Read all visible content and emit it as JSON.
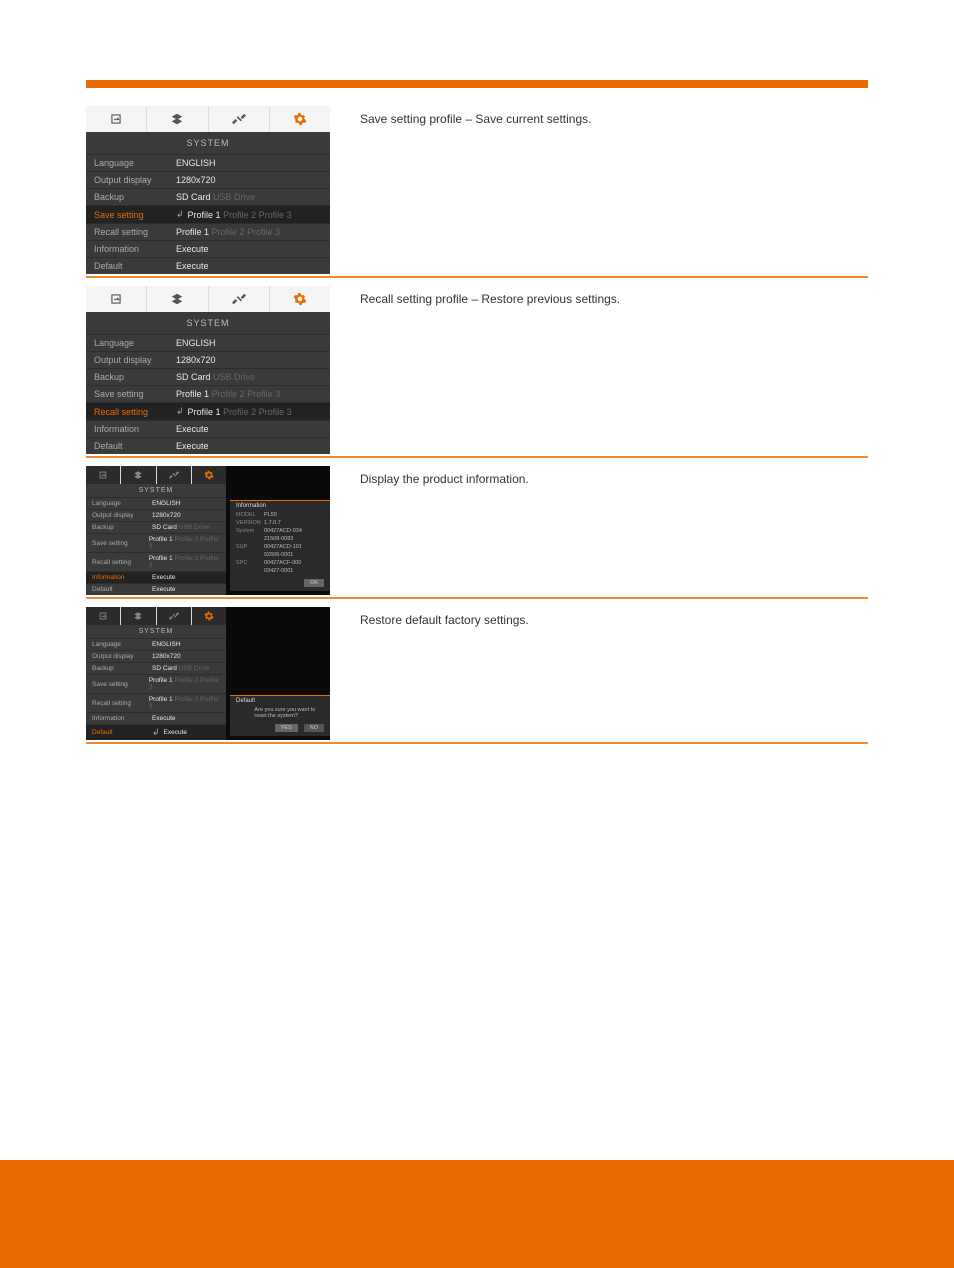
{
  "blocks": [
    {
      "desc": "Save setting profile – Save current settings.",
      "panel": {
        "title": "SYSTEM",
        "rows": [
          {
            "label": "Language",
            "vals": [
              {
                "t": "ENGLISH",
                "c": "cur"
              }
            ],
            "sel": false,
            "arrow": false
          },
          {
            "label": "Output display",
            "vals": [
              {
                "t": "1280x720",
                "c": "cur"
              }
            ],
            "sel": false,
            "arrow": false
          },
          {
            "label": "Backup",
            "vals": [
              {
                "t": "SD Card",
                "c": "cur"
              },
              {
                "t": "USB Drive",
                "c": "dim"
              }
            ],
            "sel": false,
            "arrow": false
          },
          {
            "label": "Save setting",
            "vals": [
              {
                "t": "Profile 1",
                "c": "cur"
              },
              {
                "t": "Profile 2",
                "c": "dim"
              },
              {
                "t": "Profile 3",
                "c": "dim"
              }
            ],
            "sel": true,
            "arrow": true
          },
          {
            "label": "Recall setting",
            "vals": [
              {
                "t": "Profile 1",
                "c": "cur"
              },
              {
                "t": "Profile 2",
                "c": "dim"
              },
              {
                "t": "Profile 3",
                "c": "dim"
              }
            ],
            "sel": false,
            "arrow": false
          },
          {
            "label": "Information",
            "vals": [
              {
                "t": "Execute",
                "c": "cur"
              }
            ],
            "sel": false,
            "arrow": false
          },
          {
            "label": "Default",
            "vals": [
              {
                "t": "Execute",
                "c": "cur"
              }
            ],
            "sel": false,
            "arrow": false
          }
        ]
      }
    },
    {
      "desc": "Recall setting profile – Restore previous settings.",
      "panel": {
        "title": "SYSTEM",
        "rows": [
          {
            "label": "Language",
            "vals": [
              {
                "t": "ENGLISH",
                "c": "cur"
              }
            ],
            "sel": false,
            "arrow": false
          },
          {
            "label": "Output display",
            "vals": [
              {
                "t": "1280x720",
                "c": "cur"
              }
            ],
            "sel": false,
            "arrow": false
          },
          {
            "label": "Backup",
            "vals": [
              {
                "t": "SD Card",
                "c": "cur"
              },
              {
                "t": "USB Drive",
                "c": "dim"
              }
            ],
            "sel": false,
            "arrow": false
          },
          {
            "label": "Save setting",
            "vals": [
              {
                "t": "Profile 1",
                "c": "cur"
              },
              {
                "t": "Profile 2",
                "c": "dim"
              },
              {
                "t": "Profile 3",
                "c": "dim"
              }
            ],
            "sel": false,
            "arrow": false
          },
          {
            "label": "Recall setting",
            "vals": [
              {
                "t": "Profile 1",
                "c": "cur"
              },
              {
                "t": "Profile 2",
                "c": "dim"
              },
              {
                "t": "Profile 3",
                "c": "dim"
              }
            ],
            "sel": true,
            "arrow": true
          },
          {
            "label": "Information",
            "vals": [
              {
                "t": "Execute",
                "c": "cur"
              }
            ],
            "sel": false,
            "arrow": false
          },
          {
            "label": "Default",
            "vals": [
              {
                "t": "Execute",
                "c": "cur"
              }
            ],
            "sel": false,
            "arrow": false
          }
        ]
      }
    },
    {
      "desc": "Display the product information.",
      "panel": {
        "title": "SYSTEM",
        "rows": [
          {
            "label": "Language",
            "vals": [
              {
                "t": "ENGLISH",
                "c": "cur"
              }
            ],
            "sel": false,
            "arrow": false
          },
          {
            "label": "Output display",
            "vals": [
              {
                "t": "1280x720",
                "c": "cur"
              }
            ],
            "sel": false,
            "arrow": false
          },
          {
            "label": "Backup",
            "vals": [
              {
                "t": "SD Card",
                "c": "cur"
              },
              {
                "t": "USB Drive",
                "c": "dim"
              }
            ],
            "sel": false,
            "arrow": false
          },
          {
            "label": "Save setting",
            "vals": [
              {
                "t": "Profile 1",
                "c": "cur"
              },
              {
                "t": "Profile 2",
                "c": "dim"
              },
              {
                "t": "Profile 3",
                "c": "dim"
              }
            ],
            "sel": false,
            "arrow": false
          },
          {
            "label": "Recall setting",
            "vals": [
              {
                "t": "Profile 1",
                "c": "cur"
              },
              {
                "t": "Profile 2",
                "c": "dim"
              },
              {
                "t": "Profile 3",
                "c": "dim"
              }
            ],
            "sel": false,
            "arrow": false
          },
          {
            "label": "Information",
            "vals": [
              {
                "t": "Execute",
                "c": "cur"
              }
            ],
            "sel": true,
            "arrow": false
          },
          {
            "label": "Default",
            "vals": [
              {
                "t": "Execute",
                "c": "cur"
              }
            ],
            "sel": false,
            "arrow": false
          }
        ]
      },
      "popup": {
        "head": "Information",
        "rows": [
          {
            "k": "MODEL",
            "v": "PL50"
          },
          {
            "k": "VERSION",
            "v": "1.7.0.7"
          },
          {
            "k": "System",
            "v": "00427ACD-034"
          },
          {
            "k": "",
            "v": "21508-0083"
          },
          {
            "k": "SUP",
            "v": "00427ACD-101"
          },
          {
            "k": "",
            "v": "02606-0001"
          },
          {
            "k": "SPC",
            "v": "00427ACF-000"
          },
          {
            "k": "",
            "v": "03427-0001"
          }
        ],
        "btns": [
          "OK"
        ]
      }
    },
    {
      "desc": "Restore default factory settings.",
      "panel": {
        "title": "SYSTEM",
        "rows": [
          {
            "label": "Language",
            "vals": [
              {
                "t": "ENGLISH",
                "c": "cur"
              }
            ],
            "sel": false,
            "arrow": false
          },
          {
            "label": "Output display",
            "vals": [
              {
                "t": "1280x720",
                "c": "cur"
              }
            ],
            "sel": false,
            "arrow": false
          },
          {
            "label": "Backup",
            "vals": [
              {
                "t": "SD Card",
                "c": "cur"
              },
              {
                "t": "USB Drive",
                "c": "dim"
              }
            ],
            "sel": false,
            "arrow": false
          },
          {
            "label": "Save setting",
            "vals": [
              {
                "t": "Profile 1",
                "c": "cur"
              },
              {
                "t": "Profile 2",
                "c": "dim"
              },
              {
                "t": "Profile 3",
                "c": "dim"
              }
            ],
            "sel": false,
            "arrow": false
          },
          {
            "label": "Recall setting",
            "vals": [
              {
                "t": "Profile 1",
                "c": "cur"
              },
              {
                "t": "Profile 2",
                "c": "dim"
              },
              {
                "t": "Profile 3",
                "c": "dim"
              }
            ],
            "sel": false,
            "arrow": false
          },
          {
            "label": "Information",
            "vals": [
              {
                "t": "Execute",
                "c": "cur"
              }
            ],
            "sel": false,
            "arrow": false
          },
          {
            "label": "Default",
            "vals": [
              {
                "t": "Execute",
                "c": "cur"
              }
            ],
            "sel": true,
            "arrow": true
          }
        ]
      },
      "popup": {
        "head": "Default",
        "rows": [
          {
            "k": "",
            "v": "Are you sure you want to reset the system?"
          }
        ],
        "btns": [
          "YES",
          "NO"
        ]
      }
    }
  ]
}
